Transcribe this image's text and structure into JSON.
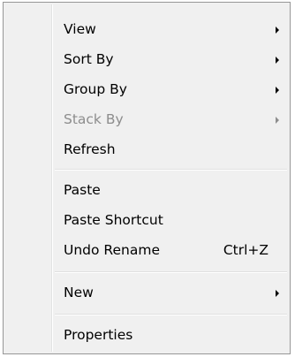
{
  "menu": {
    "items": [
      {
        "label": "View"
      },
      {
        "label": "Sort By"
      },
      {
        "label": "Group By"
      },
      {
        "label": "Stack By"
      },
      {
        "label": "Refresh"
      },
      {
        "label": "Paste"
      },
      {
        "label": "Paste Shortcut"
      },
      {
        "label": "Undo Rename",
        "shortcut": "Ctrl+Z"
      },
      {
        "label": "New"
      },
      {
        "label": "Properties"
      }
    ]
  },
  "colors": {
    "menu_background": "#f0f0f0",
    "border": "#979797",
    "disabled_text": "#8d8d8d"
  }
}
